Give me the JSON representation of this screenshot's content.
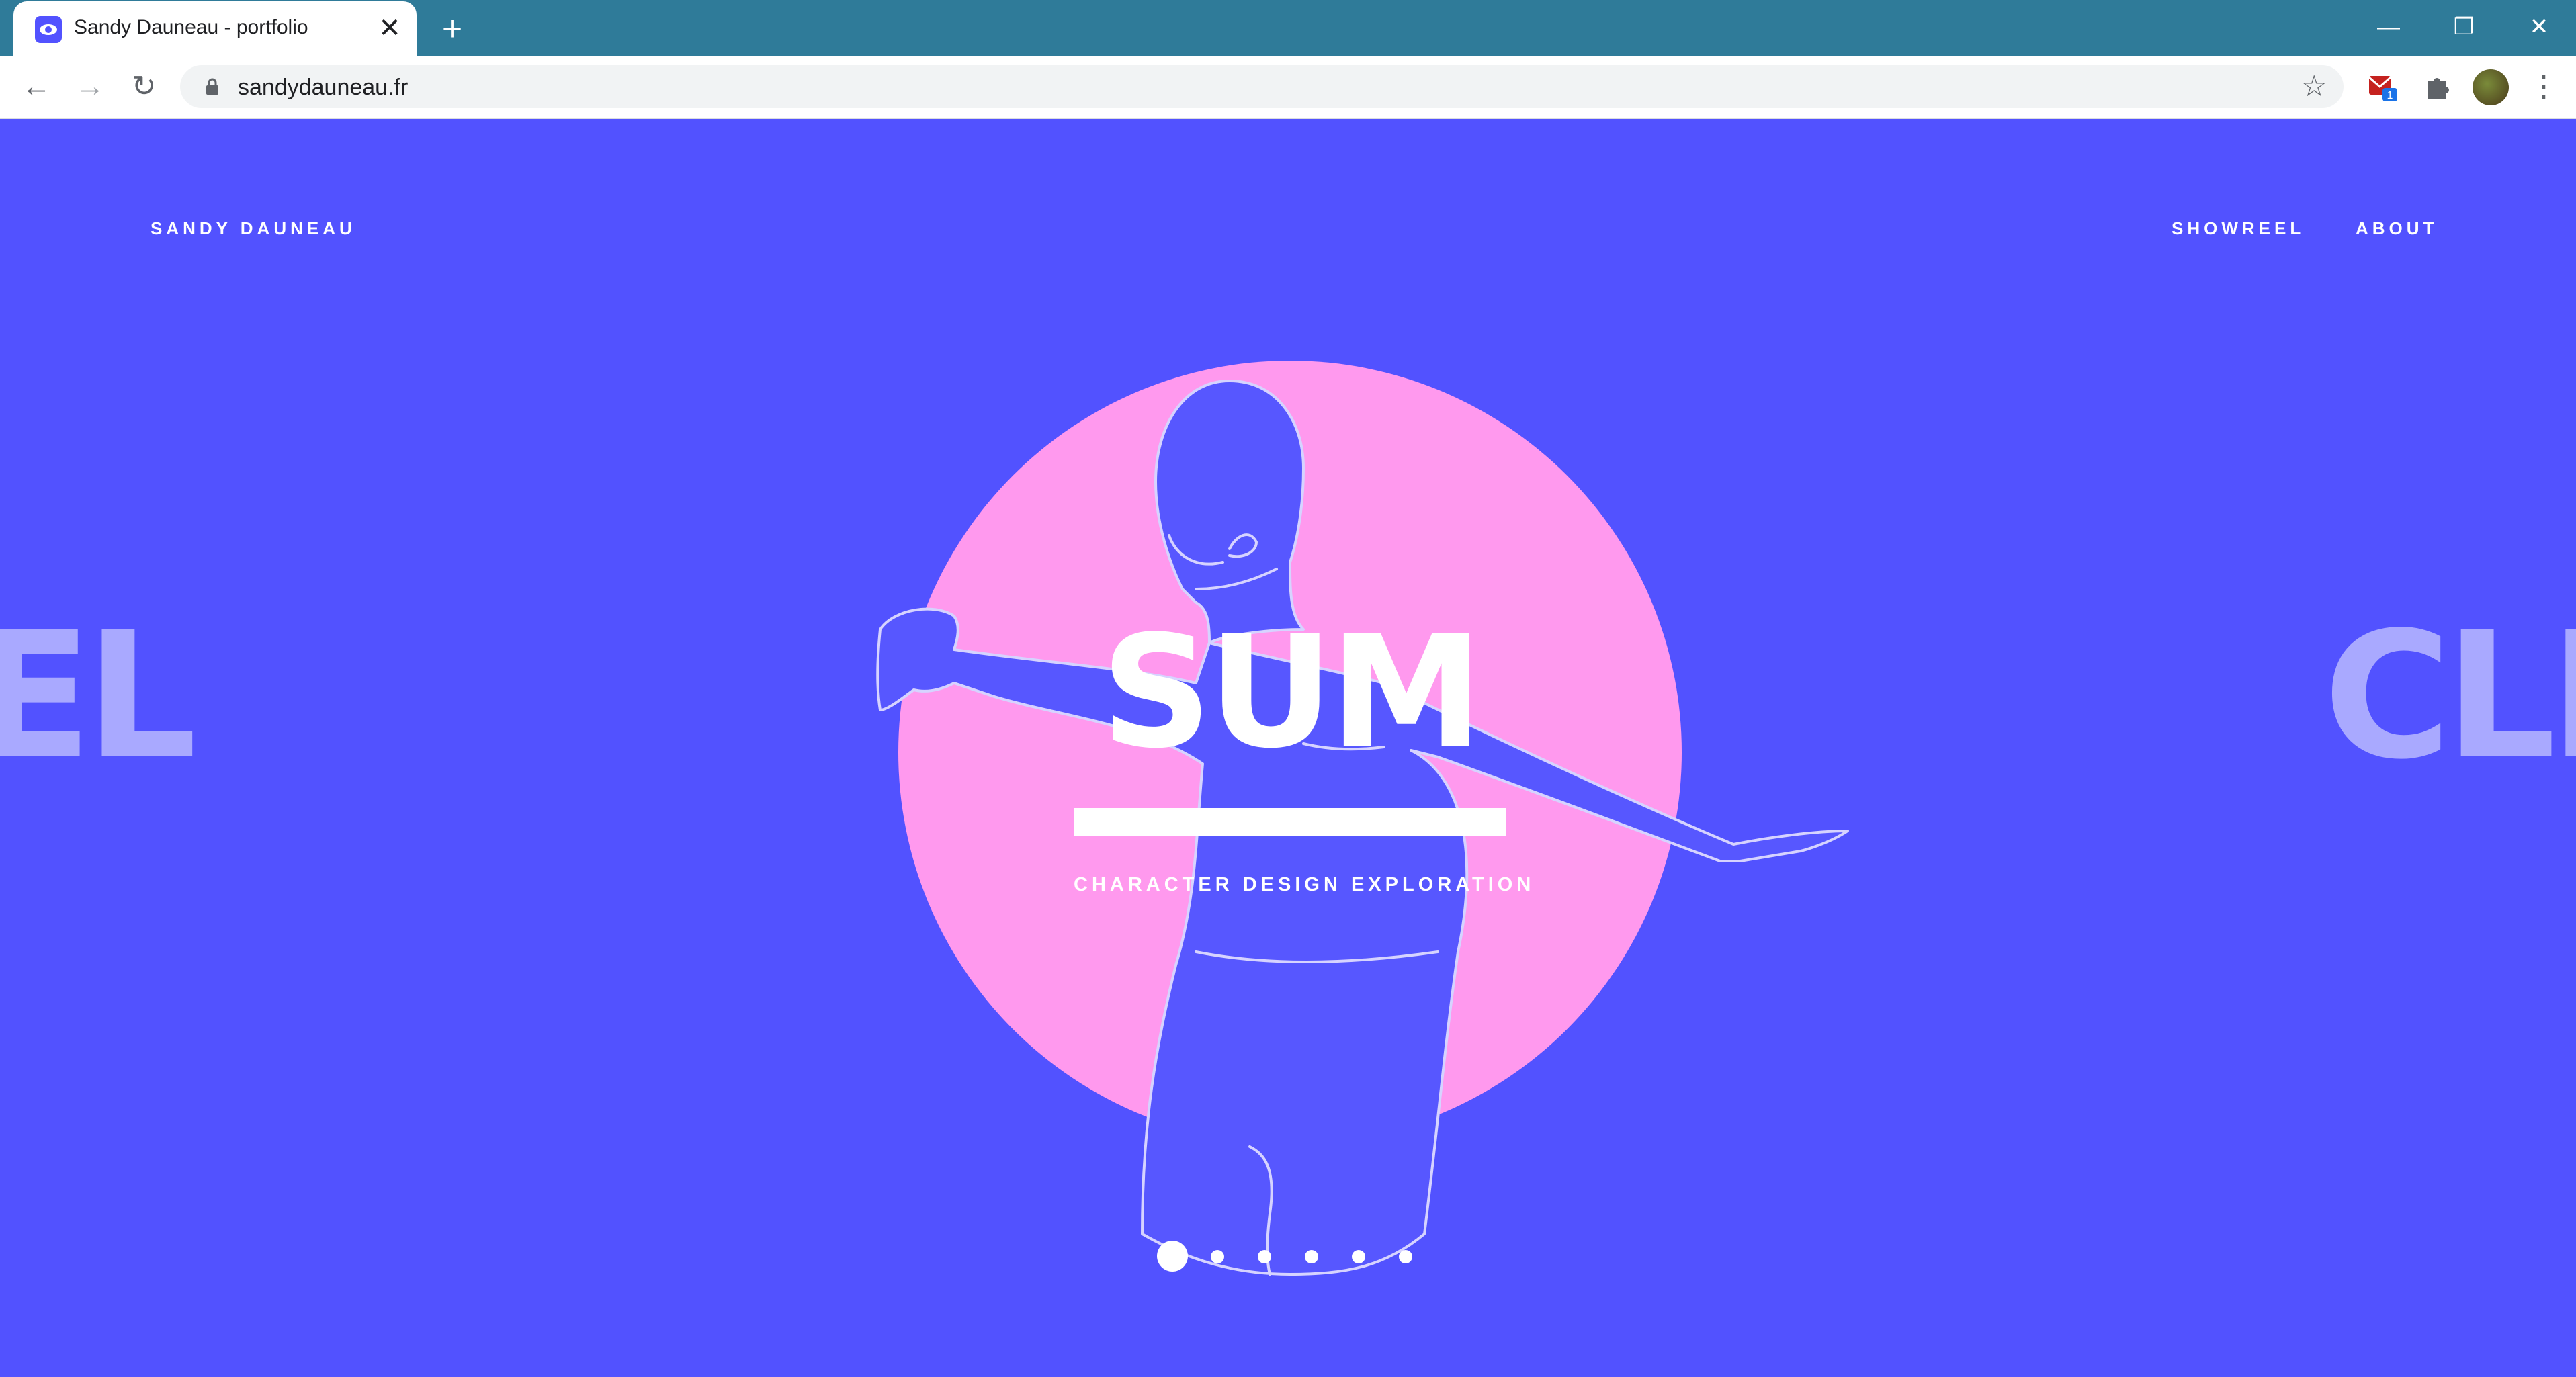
{
  "browser": {
    "tab_title": "Sandy Dauneau - portfolio",
    "tab_close": "✕",
    "new_tab": "+",
    "url": "sandydauneau.fr",
    "extension_badge": "1"
  },
  "site": {
    "brand": "SANDY DAUNEAU",
    "nav": {
      "showreel": "SHOWREEL",
      "about": "ABOUT"
    },
    "slide": {
      "title": "SUM",
      "subtitle": "CHARACTER DESIGN EXPLORATION"
    },
    "side_words": {
      "left": "EL",
      "right": "CLÉ"
    },
    "pagination": {
      "count": 6,
      "active_index": 0
    }
  },
  "colors": {
    "chrome_bar": "#2f7b99",
    "page_bg": "#5252ff",
    "circle": "#ff99ee",
    "side_word": "#a9a9ff"
  }
}
